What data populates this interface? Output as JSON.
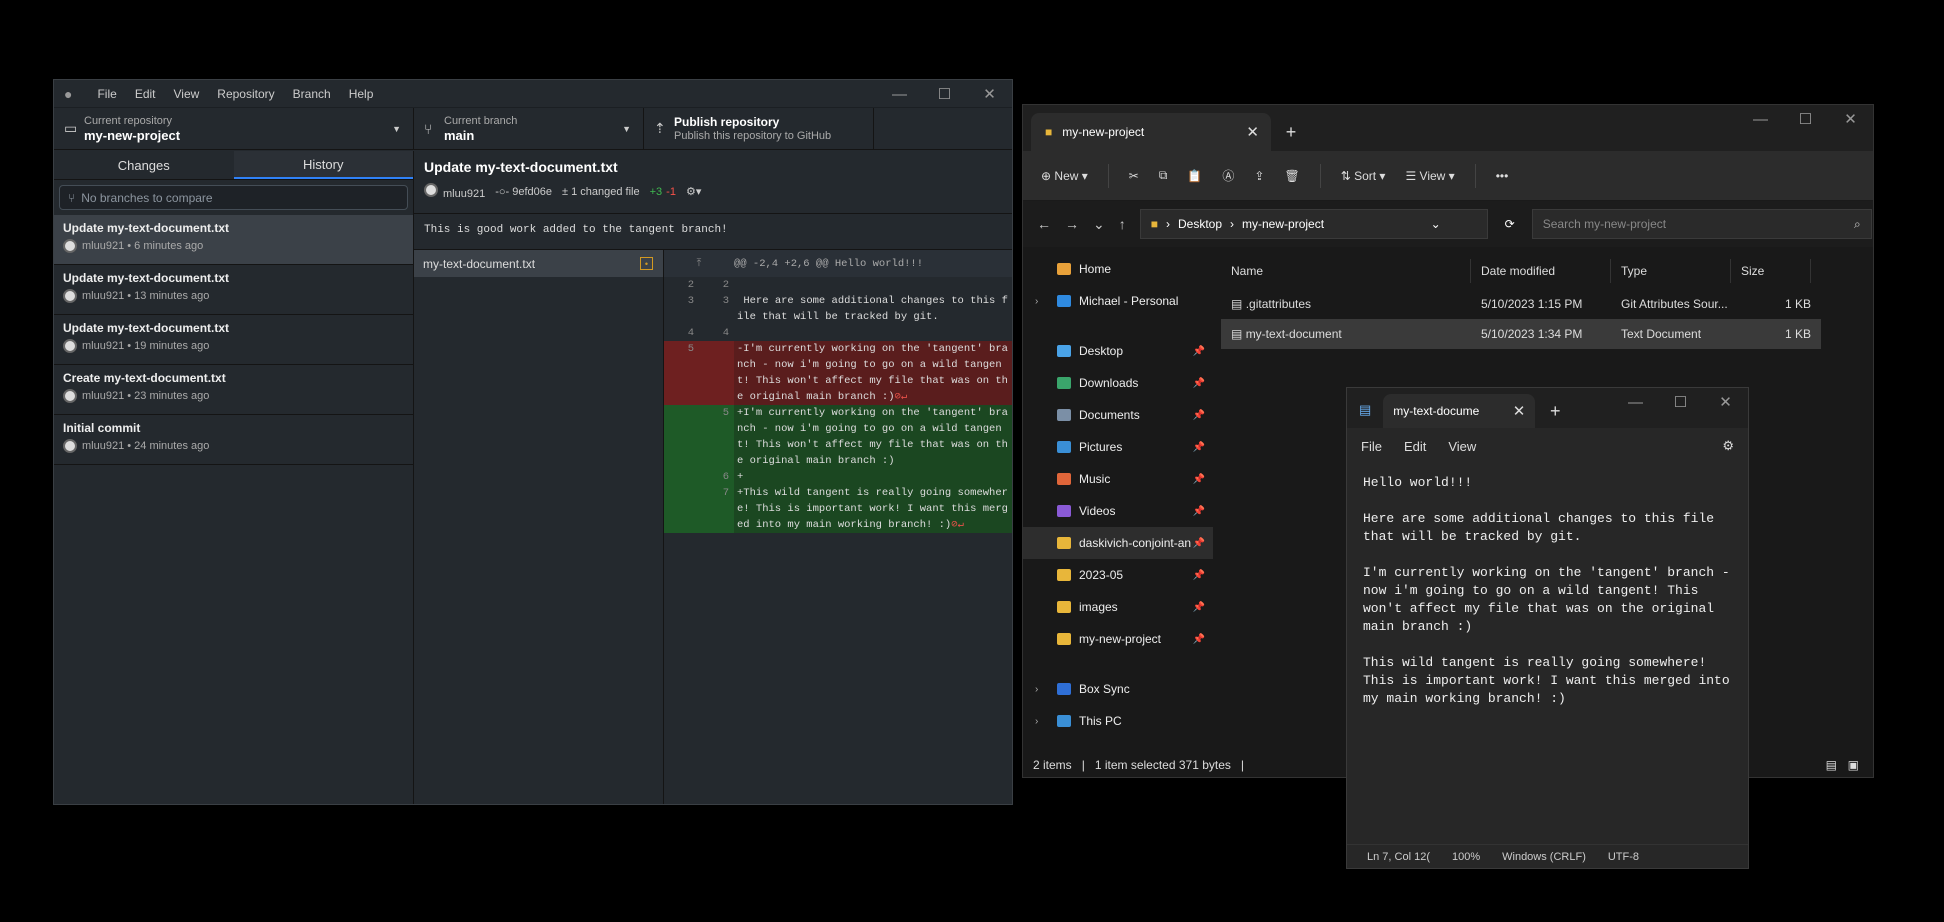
{
  "github": {
    "menu": [
      "File",
      "Edit",
      "View",
      "Repository",
      "Branch",
      "Help"
    ],
    "repo_label": "Current repository",
    "repo_value": "my-new-project",
    "branch_label": "Current branch",
    "branch_value": "main",
    "publish_title": "Publish repository",
    "publish_sub": "Publish this repository to GitHub",
    "tab_changes": "Changes",
    "tab_history": "History",
    "branch_compare_placeholder": "No branches to compare",
    "commits": [
      {
        "title": "Update my-text-document.txt",
        "meta": "mluu921 • 6 minutes ago"
      },
      {
        "title": "Update my-text-document.txt",
        "meta": "mluu921 • 13 minutes ago"
      },
      {
        "title": "Update my-text-document.txt",
        "meta": "mluu921 • 19 minutes ago"
      },
      {
        "title": "Create my-text-document.txt",
        "meta": "mluu921 • 23 minutes ago"
      },
      {
        "title": "Initial commit",
        "meta": "mluu921 • 24 minutes ago"
      }
    ],
    "detail_title": "Update my-text-document.txt",
    "detail_author": "mluu921",
    "detail_sha": "9efd06e",
    "detail_changed": "1 changed file",
    "detail_added": "+3",
    "detail_removed": "-1",
    "description": "This is good work added to the tangent branch!",
    "file_name": "my-text-document.txt",
    "hunk": "@@ -2,4 +2,6 @@ Hello world!!!",
    "diff_lines": [
      {
        "type": "ctx",
        "n1": "2",
        "n2": "2",
        "text": ""
      },
      {
        "type": "ctx",
        "n1": "3",
        "n2": "3",
        "text": " Here are some additional changes to this file that will be tracked by git."
      },
      {
        "type": "ctx",
        "n1": "4",
        "n2": "4",
        "text": ""
      },
      {
        "type": "del",
        "n1": "5",
        "n2": "",
        "text": "-I'm currently working on the 'tangent' branch - now i'm going to go on a wild tangent! This won't affect my file that was on the original main branch :)"
      },
      {
        "type": "add",
        "n1": "",
        "n2": "5",
        "text": "+I'm currently working on the 'tangent' branch - now i'm going to go on a wild tangent! This won't affect my file that was on the original main branch :)"
      },
      {
        "type": "add",
        "n1": "",
        "n2": "6",
        "text": "+"
      },
      {
        "type": "add",
        "n1": "",
        "n2": "7",
        "text": "+This wild tangent is really going somewhere! This is important work! I want this merged into my main working branch! :)"
      }
    ]
  },
  "explorer": {
    "tab_title": "my-new-project",
    "new_label": "New",
    "sort_label": "Sort",
    "view_label": "View",
    "path_1": "Desktop",
    "path_2": "my-new-project",
    "search_placeholder": "Search my-new-project",
    "sidebar": [
      {
        "label": "Home",
        "color": "#e8a13a",
        "pin": false,
        "chev": false
      },
      {
        "label": "Michael - Personal",
        "color": "#2f8ae0",
        "pin": false,
        "chev": true
      },
      {
        "label": "Desktop",
        "color": "#4aa3e8",
        "pin": true,
        "chev": false
      },
      {
        "label": "Downloads",
        "color": "#3aa56b",
        "pin": true,
        "chev": false
      },
      {
        "label": "Documents",
        "color": "#7b8fa6",
        "pin": true,
        "chev": false
      },
      {
        "label": "Pictures",
        "color": "#3a8fd6",
        "pin": true,
        "chev": false
      },
      {
        "label": "Music",
        "color": "#e0663a",
        "pin": true,
        "chev": false
      },
      {
        "label": "Videos",
        "color": "#8a5ad6",
        "pin": true,
        "chev": false
      },
      {
        "label": "daskivich-conjoint-an",
        "color": "#e8b63a",
        "pin": true,
        "chev": false
      },
      {
        "label": "2023-05",
        "color": "#e8b63a",
        "pin": true,
        "chev": false
      },
      {
        "label": "images",
        "color": "#e8b63a",
        "pin": true,
        "chev": false
      },
      {
        "label": "my-new-project",
        "color": "#e8b63a",
        "pin": true,
        "chev": false
      },
      {
        "label": "Box Sync",
        "color": "#2f6fd6",
        "pin": false,
        "chev": true
      },
      {
        "label": "This PC",
        "color": "#3a8fd6",
        "pin": false,
        "chev": true
      }
    ],
    "columns": [
      "Name",
      "Date modified",
      "Type",
      "Size"
    ],
    "files": [
      {
        "name": ".gitattributes",
        "date": "5/10/2023 1:15 PM",
        "type": "Git Attributes Sour...",
        "size": "1 KB"
      },
      {
        "name": "my-text-document",
        "date": "5/10/2023 1:34 PM",
        "type": "Text Document",
        "size": "1 KB"
      }
    ],
    "status_items": "2 items",
    "status_selected": "1 item selected  371 bytes"
  },
  "notepad": {
    "tab_title": "my-text-docume",
    "menu": [
      "File",
      "Edit",
      "View"
    ],
    "content": "Hello world!!!\n\nHere are some additional changes to this file\nthat will be tracked by git.\n\nI'm currently working on the 'tangent' branch -\nnow i'm going to go on a wild tangent! This\nwon't affect my file that was on the original\nmain branch :)\n\nThis wild tangent is really going somewhere!\nThis is important work! I want this merged into\nmy main working branch! :)",
    "status_pos": "Ln 7, Col 12(",
    "status_zoom": "100%",
    "status_eol": "Windows (CRLF)",
    "status_enc": "UTF-8"
  }
}
